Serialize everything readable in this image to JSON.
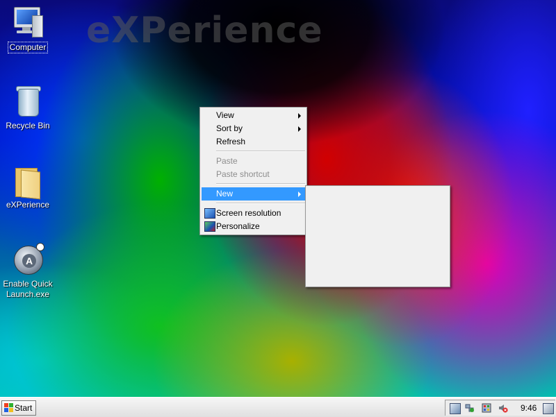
{
  "wallpaper": {
    "title": "eXPerience"
  },
  "desktop_icons": [
    {
      "label": "Computer"
    },
    {
      "label": "Recycle Bin"
    },
    {
      "label": "eXPerience"
    },
    {
      "label_line1": "Enable Quick",
      "label_line2": "Launch.exe"
    }
  ],
  "context_menu": {
    "items": [
      {
        "label": "View"
      },
      {
        "label": "Sort by"
      },
      {
        "label": "Refresh"
      },
      {
        "label": "Paste"
      },
      {
        "label": "Paste shortcut"
      },
      {
        "label": "New"
      },
      {
        "label": "Screen resolution"
      },
      {
        "label": "Personalize"
      }
    ]
  },
  "taskbar": {
    "start_label": "Start",
    "clock": "9:46"
  },
  "colors": {
    "menu_highlight": "#3399ff",
    "menu_bg": "#f0f0f0",
    "disabled_text": "#8d8d8d"
  },
  "icons": [
    "computer-icon",
    "recycle-bin-icon",
    "folder-icon",
    "quick-launch-icon",
    "windows-flag-icon",
    "screen-resolution-icon",
    "personalize-icon",
    "tray-network-icon",
    "tray-security-icon",
    "tray-volume-icon"
  ]
}
